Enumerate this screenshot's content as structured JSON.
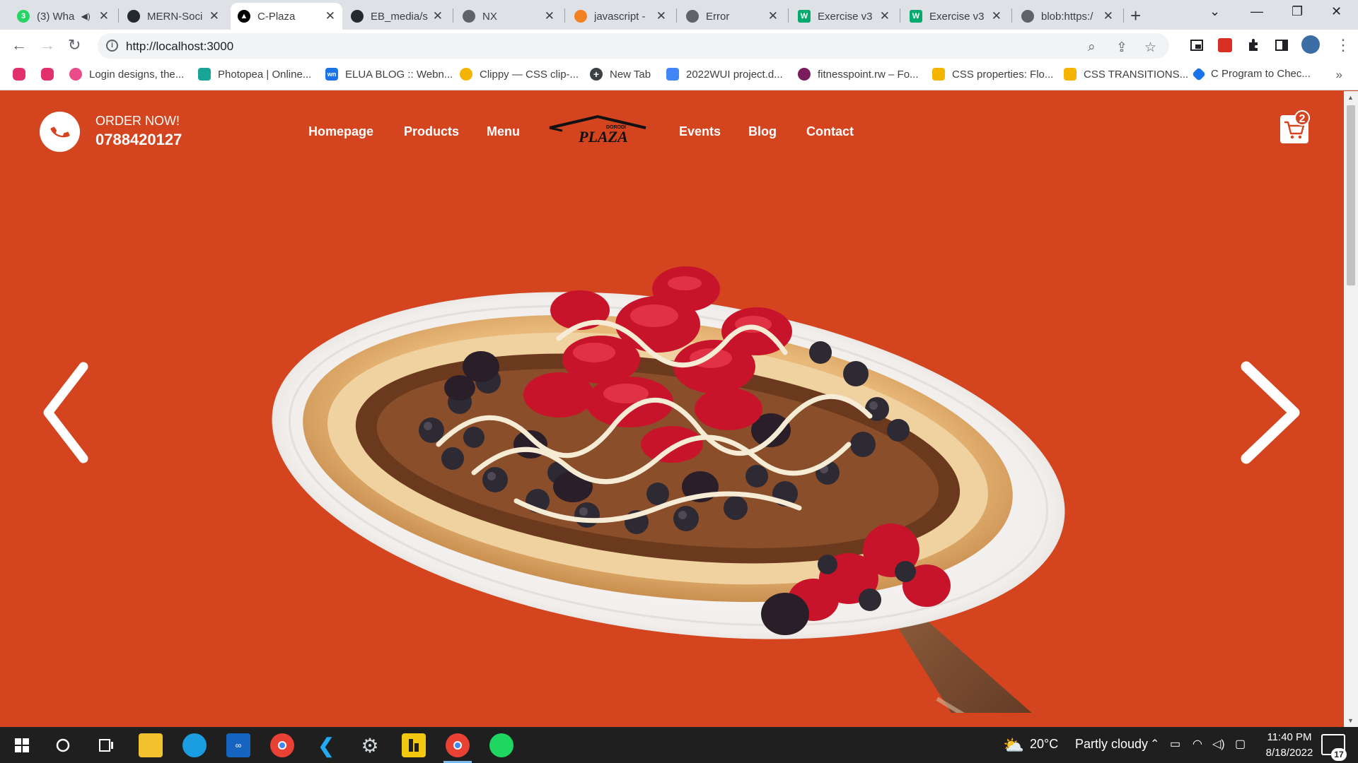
{
  "browser": {
    "tabs": [
      {
        "title": "(3) Wha",
        "badge": "3",
        "favicon_color": "#25d366",
        "active": false
      },
      {
        "title": "MERN-Soci",
        "badge": "",
        "favicon_color": "#24292f",
        "active": false
      },
      {
        "title": "C-Plaza",
        "badge": "",
        "favicon_color": "#000000",
        "active": true
      },
      {
        "title": "EB_media/s",
        "badge": "",
        "favicon_color": "#24292f",
        "active": false
      },
      {
        "title": "NX",
        "badge": "",
        "favicon_color": "#5f6368",
        "active": false
      },
      {
        "title": "javascript -",
        "badge": "",
        "favicon_color": "#f48024",
        "active": false
      },
      {
        "title": "Error",
        "badge": "",
        "favicon_color": "#5f6368",
        "active": false
      },
      {
        "title": "Exercise v3",
        "badge": "W",
        "favicon_color": "#04aa6d",
        "active": false
      },
      {
        "title": "Exercise v3",
        "badge": "W",
        "favicon_color": "#04aa6d",
        "active": false
      },
      {
        "title": "blob:https:/",
        "badge": "",
        "favicon_color": "#5f6368",
        "active": false
      }
    ],
    "url": "http://localhost:3000",
    "bookmarks": [
      {
        "label": "",
        "icon": "instagram-icon",
        "color": "#e1306c"
      },
      {
        "label": "",
        "icon": "instagram-icon",
        "color": "#e1306c"
      },
      {
        "label": "Login designs, the...",
        "icon": "dribbble-icon",
        "color": "#ea4c89"
      },
      {
        "label": "Photopea | Online...",
        "icon": "photopea-icon",
        "color": "#18a497"
      },
      {
        "label": "ELUA BLOG :: Webn...",
        "icon": "wn-icon",
        "color": "#1a73e8",
        "text": "wn"
      },
      {
        "label": "Clippy — CSS clip-...",
        "icon": "clippy-icon",
        "color": "#f4b400"
      },
      {
        "label": "New Tab",
        "icon": "plus-circle-icon",
        "color": "#3c4043"
      },
      {
        "label": "2022WUI project.d...",
        "icon": "docs-icon",
        "color": "#4285f4"
      },
      {
        "label": "fitnesspoint.rw – Fo...",
        "icon": "fitness-icon",
        "color": "#7a1d5c"
      },
      {
        "label": "CSS properties: Flo...",
        "icon": "slides-icon",
        "color": "#f4b400"
      },
      {
        "label": "CSS TRANSITIONS...",
        "icon": "slides-icon",
        "color": "#f4b400"
      },
      {
        "label": "C Program to Chec...",
        "icon": "diamond-icon",
        "color": "#1a73e8"
      }
    ],
    "bookmarks_more": "»"
  },
  "site": {
    "order_label": "ORDER NOW!",
    "phone": "0788420127",
    "nav_left": [
      "Homepage",
      "Products",
      "Menu"
    ],
    "nav_right": [
      "Events",
      "Blog",
      "Contact"
    ],
    "logo_small": "DORODI",
    "logo_text": "PLAZA",
    "cart_count": "2",
    "colors": {
      "background": "#d3441f",
      "text": "#ffffff"
    }
  },
  "taskbar": {
    "weather_temp": "20°C",
    "weather_text": "Partly cloudy",
    "time": "11:40 PM",
    "date": "8/18/2022",
    "notification_count": "17"
  }
}
